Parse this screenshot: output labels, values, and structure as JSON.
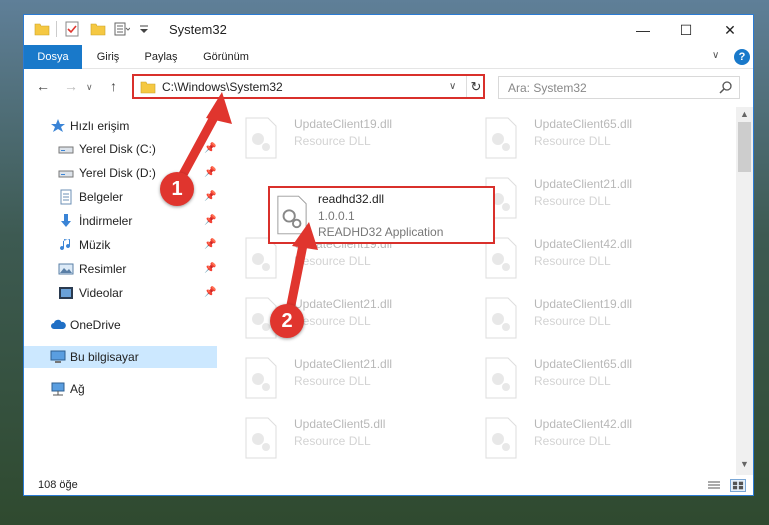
{
  "window": {
    "title": "System32",
    "controls": {
      "minimize": "—",
      "maximize": "☐",
      "close": "✕"
    }
  },
  "ribbon": {
    "tabs": [
      {
        "label": "Dosya",
        "active": true
      },
      {
        "label": "Giriş",
        "active": false
      },
      {
        "label": "Paylaş",
        "active": false
      },
      {
        "label": "Görünüm",
        "active": false
      }
    ],
    "help": "?"
  },
  "address": {
    "path": "C:\\Windows\\System32"
  },
  "search": {
    "placeholder": "Ara: System32"
  },
  "sidebar": {
    "items": [
      {
        "label": "Hızlı erişim",
        "icon": "star-icon",
        "pinned": false
      },
      {
        "label": "Yerel Disk (C:)",
        "icon": "drive-icon",
        "pinned": true
      },
      {
        "label": "Yerel Disk (D:)",
        "icon": "drive-icon",
        "pinned": true
      },
      {
        "label": "Belgeler",
        "icon": "documents-icon",
        "pinned": true
      },
      {
        "label": "İndirmeler",
        "icon": "download-icon",
        "pinned": true
      },
      {
        "label": "Müzik",
        "icon": "music-icon",
        "pinned": true
      },
      {
        "label": "Resimler",
        "icon": "pictures-icon",
        "pinned": true
      },
      {
        "label": "Videolar",
        "icon": "videos-icon",
        "pinned": true
      },
      {
        "label": "OneDrive",
        "icon": "cloud-icon",
        "pinned": false
      },
      {
        "label": "Bu bilgisayar",
        "icon": "computer-icon",
        "pinned": false,
        "selected": true
      },
      {
        "label": "Ağ",
        "icon": "network-icon",
        "pinned": false
      }
    ]
  },
  "files": {
    "left": [
      {
        "name": "UpdateClient19.dll",
        "type": "Resource DLL"
      },
      {
        "name": "readhd32.dll",
        "version": "1.0.0.1",
        "description": "READHD32 Application"
      },
      {
        "name": "UpdateClient19.dll",
        "type": "Resource DLL"
      },
      {
        "name": "UpdateClient21.dll",
        "type": "Resource DLL"
      },
      {
        "name": "UpdateClient21.dll",
        "type": "Resource DLL"
      },
      {
        "name": "UpdateClient5.dll",
        "type": "Resource DLL"
      }
    ],
    "right": [
      {
        "name": "UpdateClient65.dll",
        "type": "Resource DLL"
      },
      {
        "name": "UpdateClient21.dll",
        "type": "Resource DLL"
      },
      {
        "name": "UpdateClient42.dll",
        "type": "Resource DLL"
      },
      {
        "name": "UpdateClient19.dll",
        "type": "Resource DLL"
      },
      {
        "name": "UpdateClient65.dll",
        "type": "Resource DLL"
      },
      {
        "name": "UpdateClient42.dll",
        "type": "Resource DLL"
      }
    ]
  },
  "status": {
    "count": "108 öğe"
  },
  "annotations": {
    "step1": "1",
    "step2": "2",
    "color": "#e0352e"
  }
}
